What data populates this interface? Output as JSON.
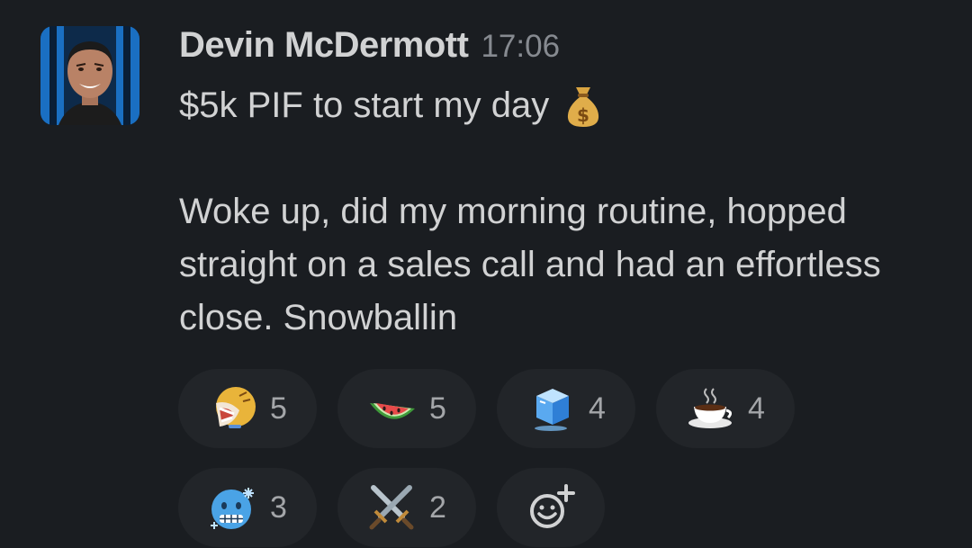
{
  "message": {
    "sender": "Devin McDermott",
    "timestamp": "17:06",
    "line1": "$5k PIF to start my day",
    "line1_emoji": "money-bag",
    "paragraph": "Woke up, did my morning routine, hopped straight on a sales call and had an effortless close. Snowballin"
  },
  "reactions": [
    {
      "emoji": "custom-laughing-face",
      "count": "5"
    },
    {
      "emoji": "watermelon",
      "count": "5"
    },
    {
      "emoji": "ice-cube",
      "count": "4"
    },
    {
      "emoji": "hot-beverage",
      "count": "4"
    },
    {
      "emoji": "cold-face",
      "count": "3"
    },
    {
      "emoji": "crossed-swords",
      "count": "2"
    }
  ],
  "add_reaction": {
    "icon": "add-reaction-icon"
  },
  "colors": {
    "background": "#1a1d21",
    "pill": "#222529",
    "text": "#d1d2d3",
    "muted": "#868a90"
  }
}
